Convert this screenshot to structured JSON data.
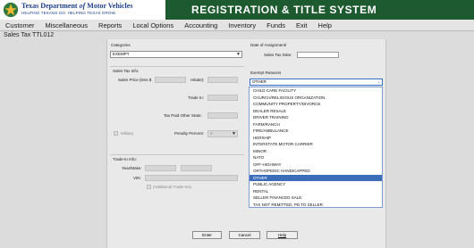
{
  "header": {
    "logo_title_prefix": "Texas Department",
    "logo_title_of": "of",
    "logo_title_suffix": "Motor Vehicles",
    "logo_tagline": "HELPING TEXANS GO. HELPING TEXAS GROW.",
    "system_title": "REGISTRATION & TITLE SYSTEM",
    "brand_color": "#1d5a2f"
  },
  "menu": [
    "Customer",
    "Miscellaneous",
    "Reports",
    "Local Options",
    "Accounting",
    "Inventory",
    "Funds",
    "Exit",
    "Help"
  ],
  "screen_title": "Sales Tax TTL012",
  "form": {
    "categories_label": "Categories",
    "categories_value": "EXEMPT",
    "date_assignment_label": "Date of Assignment/",
    "sales_tax_date_label": "Sales Tax Date:",
    "sales_tax_info_label": "Sales Tax Info:",
    "sales_price_label": "Sales Price (less $",
    "rebates_label": "rebate):",
    "trade_in_label": "Trade In:",
    "tax_paid_label": "Tax Paid Other State:",
    "military_label": "Military",
    "penalty_label": "Penalty Percent:",
    "penalty_value": "0",
    "trade_in_info_label": "Trade-In Info:",
    "year_make_label": "Year/Make:",
    "vin_label": "VIN:",
    "additional_trade_label": "(Additional Trade-Ins)",
    "exempt_reasons_label": "Exempt Reasons",
    "exempt_reason_value": "OTHER"
  },
  "exempt_reasons": [
    "CHILD CARE FACILITY",
    "CHURCH/RELIGIOUS ORGANIZATION",
    "COMMUNITY PROPERTY/DIVORCE",
    "DEALER RESALE",
    "DRIVER TRAINING",
    "FARM/RANCH",
    "FIRE/AMBULANCE",
    "HERSHIP",
    "INTERSTATE MOTOR CARRIER",
    "MINOR",
    "NATO",
    "OFF-HIGHWAY",
    "ORTHOPEDIC HANDICAPPED",
    "OTHER",
    "PUBLIC AGENCY",
    "RENTAL",
    "SELLER FINANCED SALE",
    "TAX NOT REMITTED, PD TO SELLER"
  ],
  "selected_reason": "OTHER",
  "buttons": {
    "enter": "Enter",
    "cancel": "Cancel",
    "help": "Help"
  }
}
